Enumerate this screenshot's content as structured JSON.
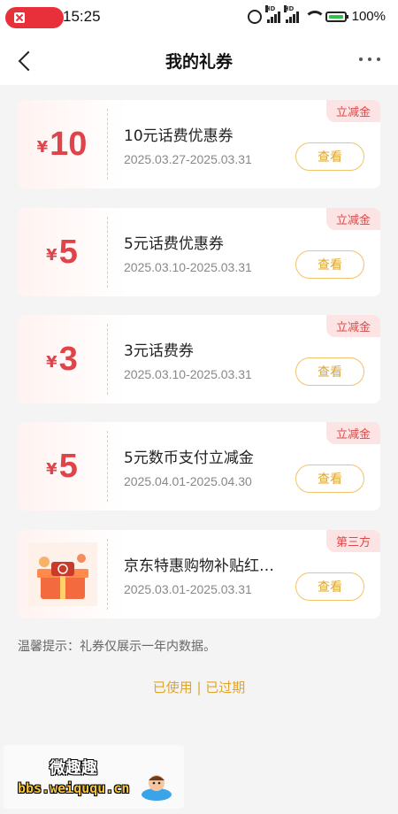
{
  "status_bar": {
    "time": "15:25",
    "battery": "100%",
    "signal_label": "HD"
  },
  "header": {
    "title": "我的礼券"
  },
  "coupons": [
    {
      "currency": "¥",
      "amount": "10",
      "name": "10元话费优惠券",
      "dates": "2025.03.27-2025.03.31",
      "tag": "立减金",
      "button": "查看"
    },
    {
      "currency": "¥",
      "amount": "5",
      "name": "5元话费优惠券",
      "dates": "2025.03.10-2025.03.31",
      "tag": "立减金",
      "button": "查看"
    },
    {
      "currency": "¥",
      "amount": "3",
      "name": "3元话费券",
      "dates": "2025.03.10-2025.03.31",
      "tag": "立减金",
      "button": "查看"
    },
    {
      "currency": "¥",
      "amount": "5",
      "name": "5元数币支付立减金",
      "dates": "2025.04.01-2025.04.30",
      "tag": "立减金",
      "button": "查看"
    },
    {
      "image": "gift-box-icon",
      "name": "京东特惠购物补贴红…",
      "dates": "2025.03.01-2025.03.31",
      "tag": "第三方",
      "button": "查看"
    }
  ],
  "tip": "温馨提示：礼券仅展示一年内数据。",
  "footer": {
    "used": "已使用",
    "separator": " | ",
    "expired": "已过期"
  },
  "watermark": {
    "top": "微趣趣",
    "bottom": "bbs.weiququ.cn"
  },
  "colors": {
    "accent_red": "#e0434a",
    "button_gold": "#e0a42c",
    "tag_bg": "#fde4e4"
  }
}
